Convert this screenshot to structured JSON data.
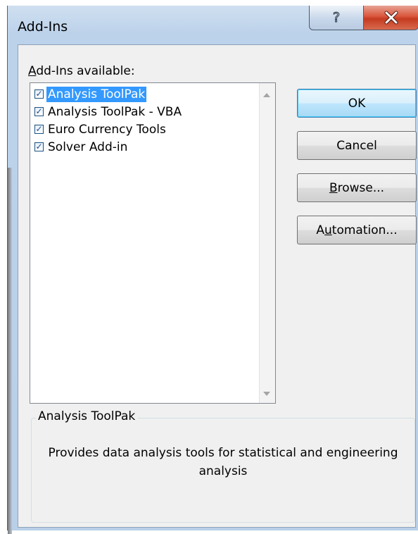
{
  "window": {
    "title": "Add-Ins",
    "help_glyph": "?",
    "close_glyph": "X"
  },
  "list": {
    "label_prefix": "",
    "label_accel": "A",
    "label_rest": "dd-Ins available:",
    "items": [
      {
        "label": "Analysis ToolPak",
        "checked": true,
        "selected": true
      },
      {
        "label": "Analysis ToolPak - VBA",
        "checked": true,
        "selected": false
      },
      {
        "label": "Euro Currency Tools",
        "checked": true,
        "selected": false
      },
      {
        "label": "Solver Add-in",
        "checked": true,
        "selected": false
      }
    ],
    "check_glyph": "✓"
  },
  "buttons": {
    "ok": "OK",
    "cancel": "Cancel",
    "browse_accel": "B",
    "browse_rest": "rowse...",
    "automation_pre": "A",
    "automation_accel": "u",
    "automation_rest": "tomation..."
  },
  "description": {
    "title": "Analysis ToolPak",
    "text": "Provides data analysis tools for statistical and engineering analysis"
  }
}
